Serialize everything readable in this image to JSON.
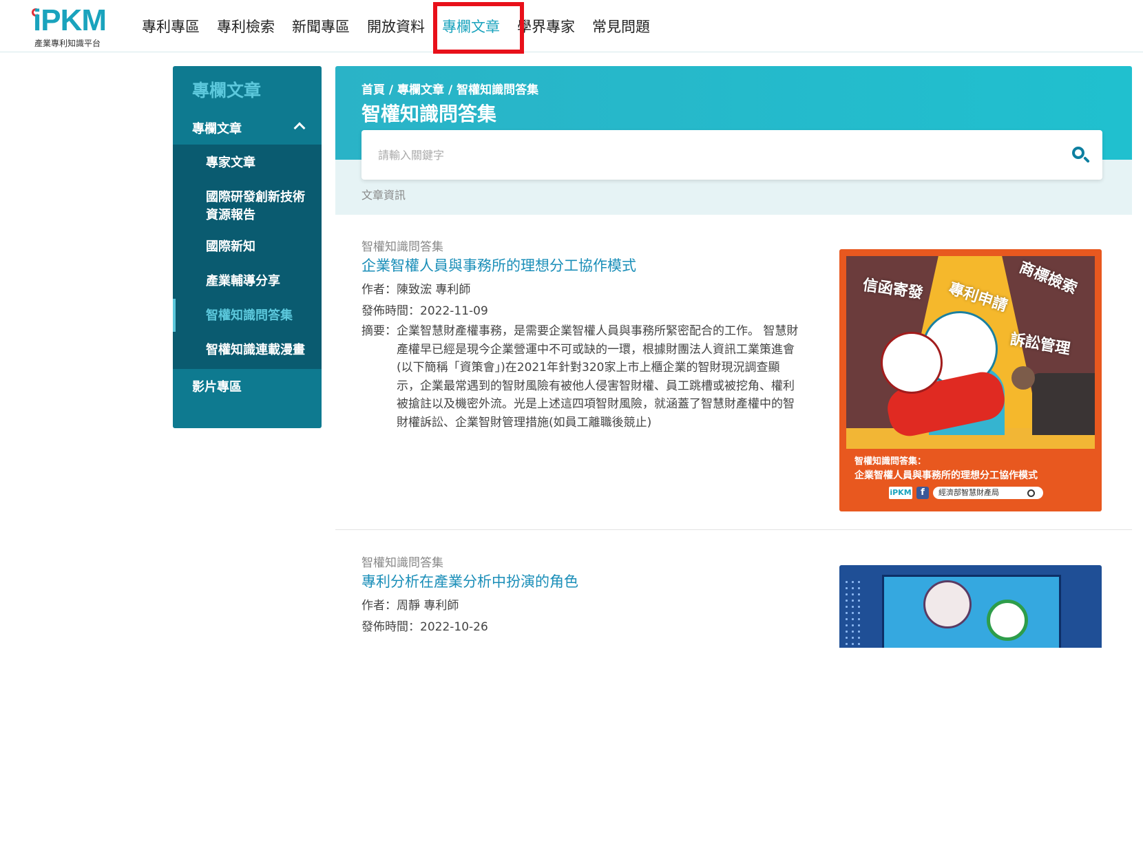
{
  "header": {
    "logo_text": "iPKM",
    "logo_subtitle": "產業專利知識平台",
    "nav": [
      {
        "label": "專利專區"
      },
      {
        "label": "專利檢索"
      },
      {
        "label": "新聞專區"
      },
      {
        "label": "開放資料"
      },
      {
        "label": "專欄文章",
        "active": true
      },
      {
        "label": "學界專家"
      },
      {
        "label": "常見問題"
      }
    ]
  },
  "sidebar": {
    "title": "專欄文章",
    "section_label": "專欄文章",
    "items": [
      {
        "label": "專家文章"
      },
      {
        "label": "國際研發創新技術資源報告"
      },
      {
        "label": "國際新知"
      },
      {
        "label": "產業輔導分享"
      },
      {
        "label": "智權知識問答集",
        "active": true
      },
      {
        "label": "智權知識連載漫畫"
      }
    ],
    "video_label": "影片專區"
  },
  "main": {
    "breadcrumb": "首頁 / 專欄文章 / 智權知識問答集",
    "title": "智權知識問答集",
    "search_placeholder": "請輸入關鍵字",
    "section_label": "文章資訊"
  },
  "articles": [
    {
      "category": "智權知識問答集",
      "title": "企業智權人員與事務所的理想分工協作模式",
      "author": "作者：陳致浤 專利師",
      "date": "發佈時間：2022-11-09",
      "summary_label": "摘要：",
      "summary": "企業智慧財產權事務，是需要企業智權人員與事務所緊密配合的工作。 智慧財產權早已經是現今企業營運中不可或缺的一環，根據財團法人資訊工業策進會(以下簡稱「資策會」)在2021年針對320家上市上櫃企業的智財現況調查顯示，企業最常遇到的智財風險有被他人侵害智財權、員工跳槽或被挖角、權利被搶註以及機密外流。光是上述這四項智財風險，就涵蓋了智慧財產權中的智財權訴訟、企業智財管理措施(如員工離職後競止)",
      "image": {
        "words": [
          "信函寄發",
          "專利申請",
          "商標檢索",
          "訴訟管理"
        ],
        "caption_top": "智權知識問答集：",
        "caption_main": "企業智權人員與事務所的理想分工協作模式",
        "logo": "iPKM",
        "fb": "f",
        "search_text": "經濟部智慧財產局"
      }
    },
    {
      "category": "智權知識問答集",
      "title": "專利分析在產業分析中扮演的角色",
      "author": "作者：周靜 專利師",
      "date": "發佈時間：2022-10-26"
    }
  ]
}
